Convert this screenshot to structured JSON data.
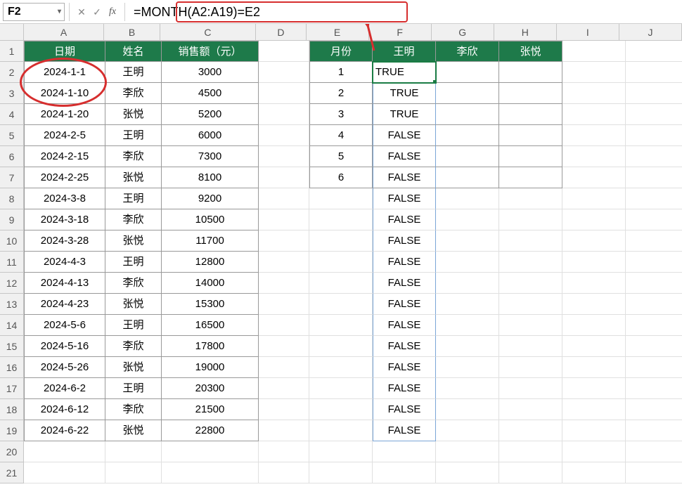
{
  "name_box": "F2",
  "formula": "=MONTH(A2:A19)=E2",
  "columns": [
    "A",
    "B",
    "C",
    "D",
    "E",
    "F",
    "G",
    "H",
    "I",
    "J"
  ],
  "row_numbers": [
    1,
    2,
    3,
    4,
    5,
    6,
    7,
    8,
    9,
    10,
    11,
    12,
    13,
    14,
    15,
    16,
    17,
    18,
    19,
    20,
    21
  ],
  "table1": {
    "headers": [
      "日期",
      "姓名",
      "销售额（元）"
    ],
    "rows": [
      [
        "2024-1-1",
        "王明",
        "3000"
      ],
      [
        "2024-1-10",
        "李欣",
        "4500"
      ],
      [
        "2024-1-20",
        "张悦",
        "5200"
      ],
      [
        "2024-2-5",
        "王明",
        "6000"
      ],
      [
        "2024-2-15",
        "李欣",
        "7300"
      ],
      [
        "2024-2-25",
        "张悦",
        "8100"
      ],
      [
        "2024-3-8",
        "王明",
        "9200"
      ],
      [
        "2024-3-18",
        "李欣",
        "10500"
      ],
      [
        "2024-3-28",
        "张悦",
        "11700"
      ],
      [
        "2024-4-3",
        "王明",
        "12800"
      ],
      [
        "2024-4-13",
        "李欣",
        "14000"
      ],
      [
        "2024-4-23",
        "张悦",
        "15300"
      ],
      [
        "2024-5-6",
        "王明",
        "16500"
      ],
      [
        "2024-5-16",
        "李欣",
        "17800"
      ],
      [
        "2024-5-26",
        "张悦",
        "19000"
      ],
      [
        "2024-6-2",
        "王明",
        "20300"
      ],
      [
        "2024-6-12",
        "李欣",
        "21500"
      ],
      [
        "2024-6-22",
        "张悦",
        "22800"
      ]
    ]
  },
  "table2": {
    "headers": [
      "月份",
      "王明",
      "李欣",
      "张悦"
    ],
    "months": [
      "1",
      "2",
      "3",
      "4",
      "5",
      "6"
    ]
  },
  "f_values": [
    "TRUE",
    "TRUE",
    "TRUE",
    "FALSE",
    "FALSE",
    "FALSE",
    "FALSE",
    "FALSE",
    "FALSE",
    "FALSE",
    "FALSE",
    "FALSE",
    "FALSE",
    "FALSE",
    "FALSE",
    "FALSE",
    "FALSE",
    "FALSE"
  ],
  "colors": {
    "header_bg": "#1e7a4a",
    "annotation": "#d62e2e",
    "active": "#1a7c44"
  }
}
